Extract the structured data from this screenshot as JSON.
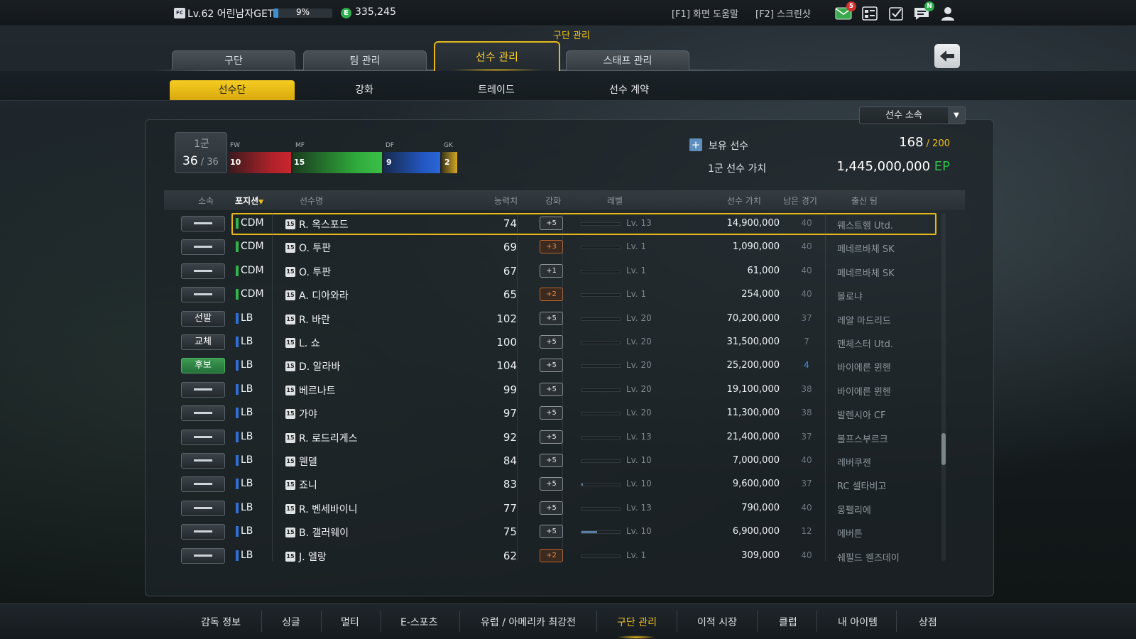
{
  "topbar": {
    "level": "Lv.62 어린남자GET",
    "xp_percent": 9,
    "xp_text": "9%",
    "ep_icon": "E",
    "ep": "335,245",
    "help": "[F1] 화면 도움말",
    "screenshot": "[F2] 스크린샷",
    "mail_badge": "5",
    "news_badge": "N"
  },
  "section_title": "구단 관리",
  "main_tabs": [
    {
      "label": "구단"
    },
    {
      "label": "팀 관리"
    },
    {
      "label": "선수 관리"
    },
    {
      "label": "스태프 관리"
    }
  ],
  "sub_tabs": [
    {
      "label": "선수단"
    },
    {
      "label": "강화"
    },
    {
      "label": "트레이드"
    },
    {
      "label": "선수 계약"
    }
  ],
  "dropdown": {
    "value": "선수 소속"
  },
  "squad": {
    "label": "1군",
    "count": "36",
    "total": " / 36",
    "positions": [
      {
        "name": "FW",
        "count": "10"
      },
      {
        "name": "MF",
        "count": "15"
      },
      {
        "name": "DF",
        "count": "9"
      },
      {
        "name": "GK",
        "count": "2"
      }
    ]
  },
  "owned": {
    "label": "보유 선수",
    "count": "168",
    "max": " / 200"
  },
  "value": {
    "label": "1군 선수 가치",
    "amount": "1,445,000,000",
    "unit": " EP"
  },
  "columns": {
    "affiliation": "소속",
    "position": "포지션",
    "name": "선수명",
    "ovr": "능력치",
    "enhance": "강화",
    "level": "레벨",
    "value": "선수 가치",
    "games": "남은 경기",
    "club": "출신 팀"
  },
  "rows": [
    {
      "aff": "",
      "pos": "CDM",
      "name": "R. 옥스포드",
      "ovr": "74",
      "enh": "+5",
      "enh_type": "silver",
      "lv_fill": 0,
      "lv": "Lv. 13",
      "value": "14,900,000",
      "games": "40",
      "club": "웨스트햄 Utd."
    },
    {
      "aff": "",
      "pos": "CDM",
      "name": "O. 투판",
      "ovr": "69",
      "enh": "+3",
      "enh_type": "bronze",
      "lv_fill": 0,
      "lv": "Lv. 1",
      "value": "1,090,000",
      "games": "40",
      "club": "페네르바체 SK"
    },
    {
      "aff": "",
      "pos": "CDM",
      "name": "O. 투판",
      "ovr": "67",
      "enh": "+1",
      "enh_type": "silver",
      "lv_fill": 0,
      "lv": "Lv. 1",
      "value": "61,000",
      "games": "40",
      "club": "페네르바체 SK"
    },
    {
      "aff": "",
      "pos": "CDM",
      "name": "A. 디아와라",
      "ovr": "65",
      "enh": "+2",
      "enh_type": "bronze",
      "lv_fill": 0,
      "lv": "Lv. 1",
      "value": "254,000",
      "games": "40",
      "club": "볼로냐"
    },
    {
      "aff": "선발",
      "pos": "LB",
      "name": "R. 바란",
      "ovr": "102",
      "enh": "+5",
      "enh_type": "silver",
      "lv_fill": 0,
      "lv": "Lv. 20",
      "value": "70,200,000",
      "games": "37",
      "club": "레알 마드리드"
    },
    {
      "aff": "교체",
      "pos": "LB",
      "name": "L. 쇼",
      "ovr": "100",
      "enh": "+5",
      "enh_type": "silver",
      "lv_fill": 0,
      "lv": "Lv. 20",
      "value": "31,500,000",
      "games": "7",
      "club": "맨체스터 Utd."
    },
    {
      "aff": "후보",
      "pos": "LB",
      "name": "D. 알라바",
      "ovr": "104",
      "enh": "+5",
      "enh_type": "silver",
      "lv_fill": 0,
      "lv": "Lv. 20",
      "value": "25,200,000",
      "games": "4",
      "club": "바이에른 뮌헨"
    },
    {
      "aff": "",
      "pos": "LB",
      "name": "베르나트",
      "ovr": "99",
      "enh": "+5",
      "enh_type": "silver",
      "lv_fill": 0,
      "lv": "Lv. 20",
      "value": "19,100,000",
      "games": "38",
      "club": "바이에른 뮌헨"
    },
    {
      "aff": "",
      "pos": "LB",
      "name": "가야",
      "ovr": "97",
      "enh": "+5",
      "enh_type": "silver",
      "lv_fill": 0,
      "lv": "Lv. 20",
      "value": "11,300,000",
      "games": "38",
      "club": "발렌시아 CF"
    },
    {
      "aff": "",
      "pos": "LB",
      "name": "R. 로드리게스",
      "ovr": "92",
      "enh": "+5",
      "enh_type": "silver",
      "lv_fill": 0,
      "lv": "Lv. 13",
      "value": "21,400,000",
      "games": "37",
      "club": "볼프스부르크"
    },
    {
      "aff": "",
      "pos": "LB",
      "name": "웬델",
      "ovr": "84",
      "enh": "+5",
      "enh_type": "silver",
      "lv_fill": 0,
      "lv": "Lv. 10",
      "value": "7,000,000",
      "games": "40",
      "club": "레버쿠젠"
    },
    {
      "aff": "",
      "pos": "LB",
      "name": "죠니",
      "ovr": "83",
      "enh": "+5",
      "enh_type": "silver",
      "lv_fill": 0.03,
      "lv": "Lv. 10",
      "value": "9,600,000",
      "games": "37",
      "club": "RC 셀타비고"
    },
    {
      "aff": "",
      "pos": "LB",
      "name": "R. 벤세바이니",
      "ovr": "77",
      "enh": "+5",
      "enh_type": "silver",
      "lv_fill": 0,
      "lv": "Lv. 13",
      "value": "790,000",
      "games": "40",
      "club": "몽펠리에"
    },
    {
      "aff": "",
      "pos": "LB",
      "name": "B. 갤러웨이",
      "ovr": "75",
      "enh": "+5",
      "enh_type": "silver",
      "lv_fill": 0.4,
      "lv": "Lv. 10",
      "value": "6,900,000",
      "games": "12",
      "club": "에버튼"
    },
    {
      "aff": "",
      "pos": "LB",
      "name": "J. 엘랑",
      "ovr": "62",
      "enh": "+2",
      "enh_type": "bronze",
      "lv_fill": 0,
      "lv": "Lv. 1",
      "value": "309,000",
      "games": "40",
      "club": "쉐필드 웬즈데이"
    }
  ],
  "bottom_nav": [
    {
      "label": "감독 정보"
    },
    {
      "label": "싱글"
    },
    {
      "label": "멀티"
    },
    {
      "label": "E-스포츠"
    },
    {
      "label": "유럽 / 아메리카 최강전"
    },
    {
      "label": "구단 관리"
    },
    {
      "label": "이적 시장"
    },
    {
      "label": "클럽"
    },
    {
      "label": "내 아이템"
    },
    {
      "label": "상점"
    }
  ]
}
